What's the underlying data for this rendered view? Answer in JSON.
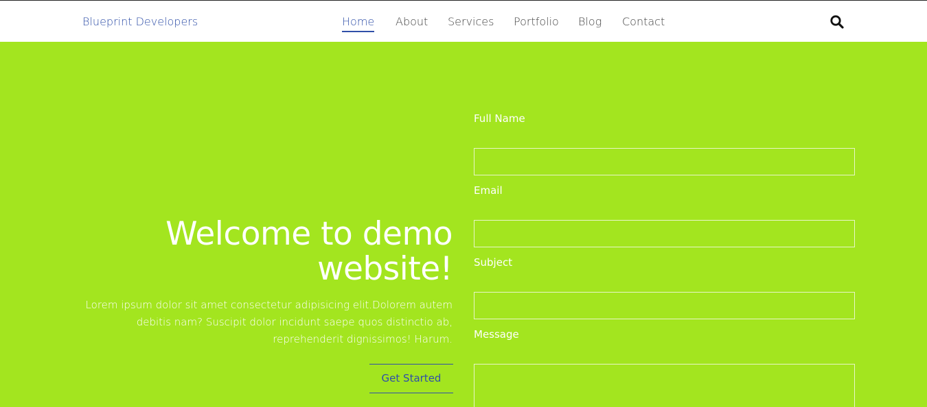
{
  "header": {
    "brand": "Blueprint Developers",
    "nav": [
      {
        "label": "Home",
        "active": true
      },
      {
        "label": "About",
        "active": false
      },
      {
        "label": "Services",
        "active": false
      },
      {
        "label": "Portfolio",
        "active": false
      },
      {
        "label": "Blog",
        "active": false
      },
      {
        "label": "Contact",
        "active": false
      }
    ],
    "search_icon": "search-icon"
  },
  "hero": {
    "title_line1": "Welcome to demo",
    "title_line2": "website!",
    "text": "Lorem ipsum dolor sit amet consectetur adipisicing elit.Dolorem autem debitis nam? Suscipit dolor incidunt saepe quos distinctio ab, reprehenderit dignissimos! Harum.",
    "cta_label": "Get Started"
  },
  "form": {
    "full_name_label": "Full Name",
    "full_name_value": "",
    "email_label": "Email",
    "email_value": "",
    "subject_label": "Subject",
    "subject_value": "",
    "message_label": "Message",
    "message_value": ""
  },
  "colors": {
    "accent": "#2f4fa8",
    "hero_background": "#a3e51f",
    "header_background": "#ffffff",
    "nav_text": "#444444"
  }
}
